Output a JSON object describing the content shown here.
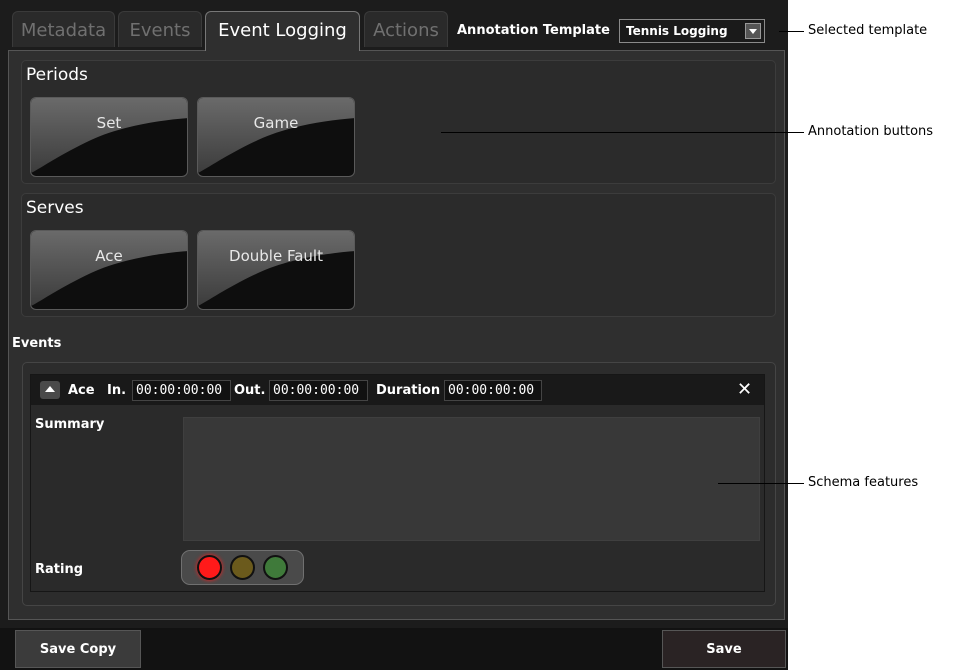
{
  "tabs": [
    {
      "label": "Metadata",
      "active": false
    },
    {
      "label": "Events",
      "active": false
    },
    {
      "label": "Event Logging",
      "active": true
    },
    {
      "label": "Actions",
      "active": false
    }
  ],
  "template": {
    "label": "Annotation Template",
    "value": "Tennis Logging"
  },
  "groups": [
    {
      "title": "Periods",
      "buttons": [
        "Set",
        "Game"
      ]
    },
    {
      "title": "Serves",
      "buttons": [
        "Ace",
        "Double Fault"
      ]
    }
  ],
  "events": {
    "label": "Events",
    "entry": {
      "name": "Ace",
      "in_label": "In.",
      "in_value": "00:00:00:00",
      "out_label": "Out.",
      "out_value": "00:00:00:00",
      "duration_label": "Duration",
      "duration_value": "00:00:00:00",
      "close_icon": "✕",
      "summary_label": "Summary",
      "summary_value": "",
      "rating_label": "Rating",
      "rating_lights": [
        {
          "color": "#ff1a1a",
          "active": true
        },
        {
          "color": "#6b5a1c",
          "active": false
        },
        {
          "color": "#3f7a3a",
          "active": false
        }
      ]
    }
  },
  "footer": {
    "save_copy": "Save Copy",
    "save": "Save"
  },
  "callouts": {
    "selected_template": "Selected template",
    "annotation_buttons": "Annotation buttons",
    "schema_features": "Schema features"
  },
  "colors": {
    "accent_red": "#ff1a1a",
    "panel_bg": "#1c1c1c",
    "content_bg": "#2f2f2f"
  }
}
